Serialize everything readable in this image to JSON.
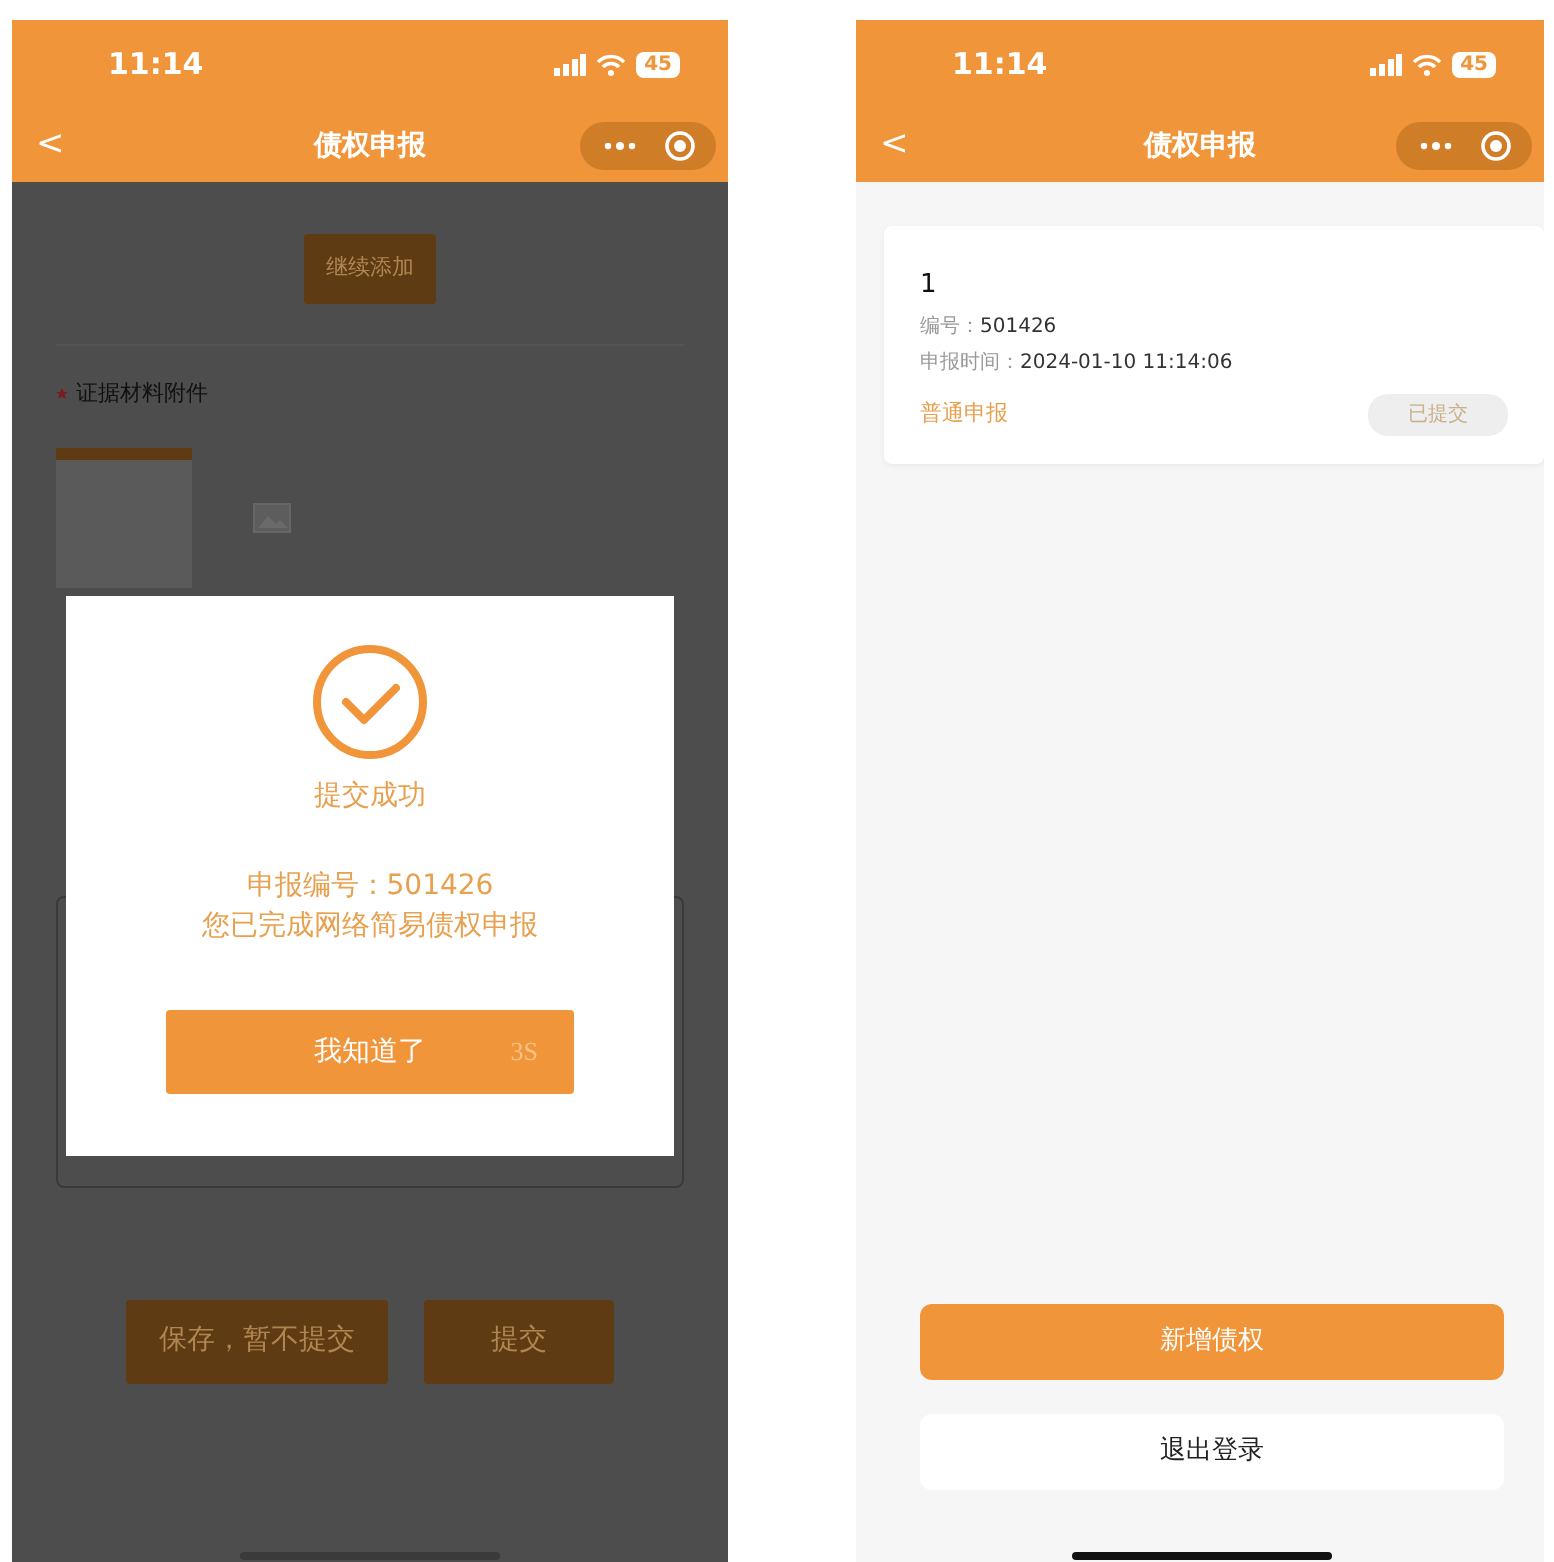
{
  "dialog_screen": {
    "status_bar": {
      "time": "11:14",
      "battery": "45"
    },
    "nav_bar": {
      "back": "<",
      "title": "债权申报"
    },
    "form": {
      "add_button": "继续添加",
      "attachments": {
        "label": "证据材料附件",
        "required": true
      },
      "buttons": [
        {
          "label": "保存，暂不提交"
        },
        {
          "label": "提交"
        }
      ]
    },
    "dialog": {
      "title": "提交成功",
      "lines": [
        "申报编号：501426",
        "您已完成网络简易债权申报"
      ],
      "button": "我知道了",
      "countdown": "3S"
    }
  },
  "list_screen": {
    "status_bar": {
      "time": "11:14",
      "battery": "45"
    },
    "nav_bar": {
      "back": "<",
      "title": "债权申报"
    },
    "claims": [
      {
        "index": "1",
        "number_label": "编号：",
        "number": "501426",
        "time_label": "申报时间：",
        "time": "2024-01-10 11:14:06",
        "type": "普通申报",
        "status": "已提交"
      }
    ],
    "buttons": [
      {
        "label": "新增债权",
        "kind": "primary"
      },
      {
        "label": "退出登录",
        "kind": "secondary"
      }
    ]
  }
}
